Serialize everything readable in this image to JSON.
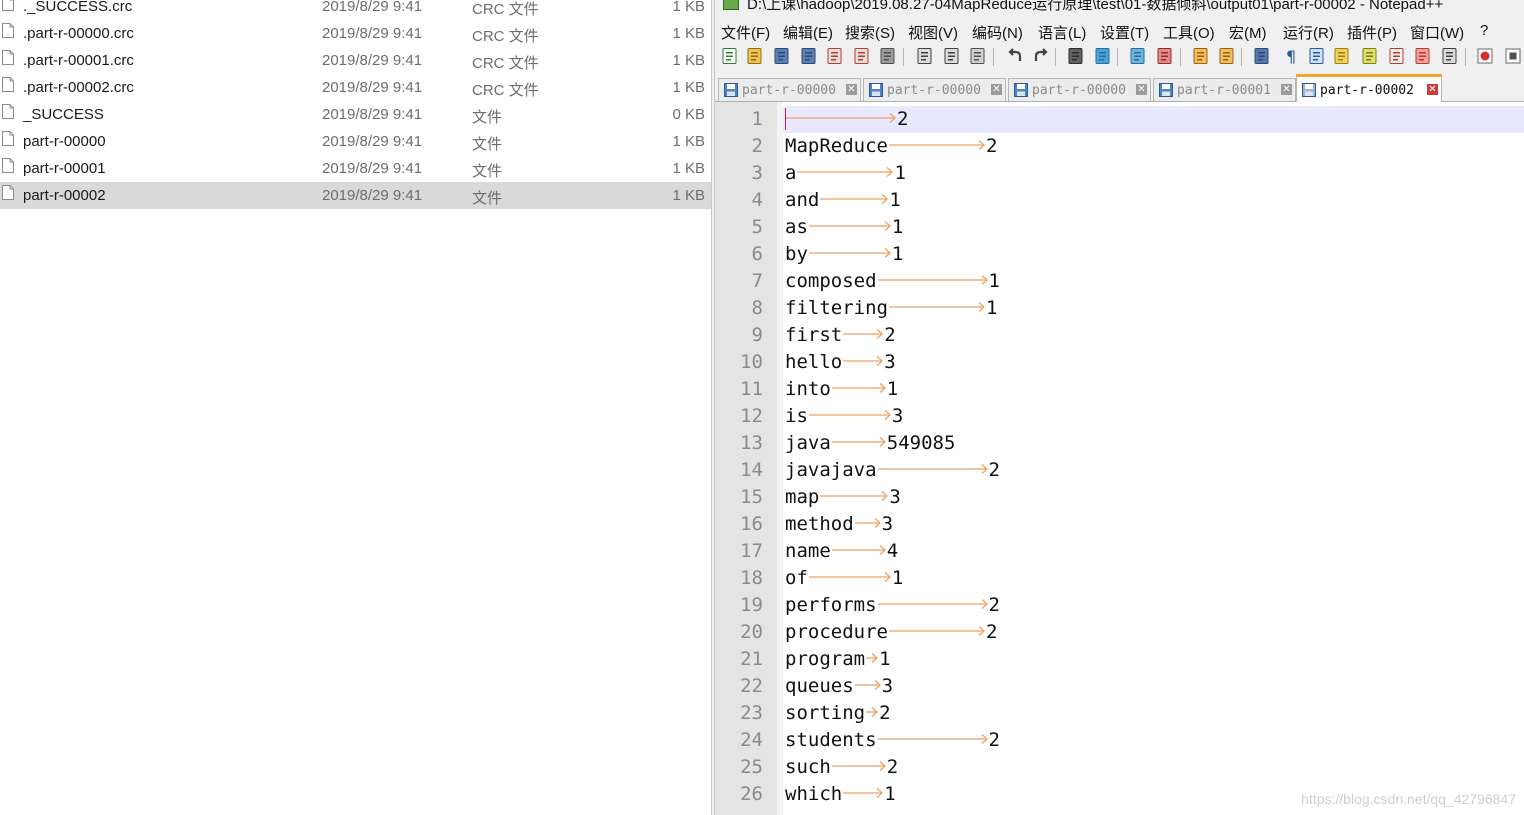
{
  "explorer": {
    "files": [
      {
        "name": "._SUCCESS.crc",
        "date": "2019/8/29 9:41",
        "type": "CRC 文件",
        "size": "1 KB",
        "selected": false
      },
      {
        "name": ".part-r-00000.crc",
        "date": "2019/8/29 9:41",
        "type": "CRC 文件",
        "size": "1 KB",
        "selected": false
      },
      {
        "name": ".part-r-00001.crc",
        "date": "2019/8/29 9:41",
        "type": "CRC 文件",
        "size": "1 KB",
        "selected": false
      },
      {
        "name": ".part-r-00002.crc",
        "date": "2019/8/29 9:41",
        "type": "CRC 文件",
        "size": "1 KB",
        "selected": false
      },
      {
        "name": "_SUCCESS",
        "date": "2019/8/29 9:41",
        "type": "文件",
        "size": "0 KB",
        "selected": false
      },
      {
        "name": "part-r-00000",
        "date": "2019/8/29 9:41",
        "type": "文件",
        "size": "1 KB",
        "selected": false
      },
      {
        "name": "part-r-00001",
        "date": "2019/8/29 9:41",
        "type": "文件",
        "size": "1 KB",
        "selected": false
      },
      {
        "name": "part-r-00002",
        "date": "2019/8/29 9:41",
        "type": "文件",
        "size": "1 KB",
        "selected": true
      }
    ]
  },
  "notepad": {
    "title": "D:\\上课\\hadoop\\2019.08.27-04MapReduce运行原理\\test\\01-数据倾斜\\output01\\part-r-00002 - Notepad++",
    "menu": [
      "文件(F)",
      "编辑(E)",
      "搜索(S)",
      "视图(V)",
      "编码(N)",
      "语言(L)",
      "设置(T)",
      "工具(O)",
      "宏(M)",
      "运行(R)",
      "插件(P)",
      "窗口(W)",
      "?"
    ],
    "tabs": [
      {
        "label": "part-r-00000",
        "active": false
      },
      {
        "label": "part-r-00000",
        "active": false
      },
      {
        "label": "part-r-00000",
        "active": false
      },
      {
        "label": "part-r-00001",
        "active": false
      },
      {
        "label": "part-r-00002",
        "active": true
      }
    ],
    "tab_close_glyph": "✕",
    "lines": [
      {
        "n": "1",
        "word": "",
        "count": "2"
      },
      {
        "n": "2",
        "word": "MapReduce",
        "count": "2"
      },
      {
        "n": "3",
        "word": "a",
        "count": "1"
      },
      {
        "n": "4",
        "word": "and",
        "count": "1"
      },
      {
        "n": "5",
        "word": "as",
        "count": "1"
      },
      {
        "n": "6",
        "word": "by",
        "count": "1"
      },
      {
        "n": "7",
        "word": "composed",
        "count": "1"
      },
      {
        "n": "8",
        "word": "filtering",
        "count": "1"
      },
      {
        "n": "9",
        "word": "first",
        "count": "2"
      },
      {
        "n": "10",
        "word": "hello",
        "count": "3"
      },
      {
        "n": "11",
        "word": "into",
        "count": "1"
      },
      {
        "n": "12",
        "word": "is",
        "count": "3"
      },
      {
        "n": "13",
        "word": "java",
        "count": "549085"
      },
      {
        "n": "14",
        "word": "javajava",
        "count": "2"
      },
      {
        "n": "15",
        "word": "map",
        "count": "3"
      },
      {
        "n": "16",
        "word": "method",
        "count": "3"
      },
      {
        "n": "17",
        "word": "name",
        "count": "4"
      },
      {
        "n": "18",
        "word": "of",
        "count": "1"
      },
      {
        "n": "19",
        "word": "performs",
        "count": "2"
      },
      {
        "n": "20",
        "word": "procedure",
        "count": "2"
      },
      {
        "n": "21",
        "word": "program",
        "count": "1"
      },
      {
        "n": "22",
        "word": "queues",
        "count": "3"
      },
      {
        "n": "23",
        "word": "sorting",
        "count": "2"
      },
      {
        "n": "24",
        "word": "students",
        "count": "2"
      },
      {
        "n": "25",
        "word": "such",
        "count": "2"
      },
      {
        "n": "26",
        "word": "which",
        "count": "1"
      }
    ],
    "colors": {
      "tab_arrow": "#f0a060",
      "active_tab_accent": "#f5a623",
      "current_line": "#e8e8ff"
    }
  },
  "watermark": "https://blog.csdn.net/qq_42796847"
}
